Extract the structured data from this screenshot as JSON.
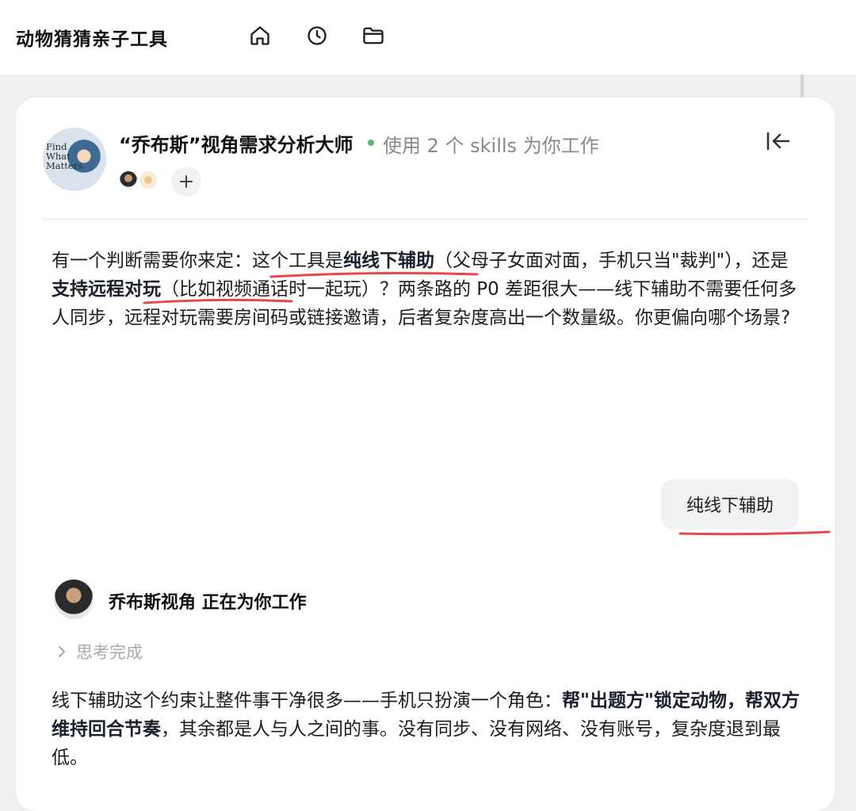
{
  "app": {
    "title": "动物猜猜亲子工具",
    "nav_icons": [
      "home-icon",
      "history-icon",
      "folder-icon"
    ]
  },
  "agent": {
    "logo_text": "Find\nWhat\nMatters.",
    "name": "“乔布斯”视角需求分析大师",
    "status": "使用 2 个 skills 为你工作",
    "status_color": "#5db56d"
  },
  "messages": {
    "assistant_question": {
      "p1": "有一个判断需要你来定：",
      "p2": "这个工具是",
      "p3": "纯线下辅助",
      "p4": "（父母子女面对面，手机只当\"裁判\"），还是",
      "p5": "支持远程对玩",
      "p6": "（比如视频通话时一起玩）？两条路的 P0 差距很大——线下辅助不需要任何多人同步，远程对玩需要房间码或链接邀请，后者复杂度高出一个数量级。你更偏向哪个场景?"
    },
    "user_reply": "纯线下辅助",
    "worker": {
      "status": "乔布斯视角 正在为你工作",
      "thinking": "思考完成"
    },
    "assistant_answer": {
      "p1": "线下辅助这个约束让整件事干净很多——手机只扮演一个角色：",
      "p2": "帮\"出题方\"锁定动物，帮双方维持回合节奏",
      "p3": "，其余都是人与人之间的事。没有同步、没有网络、没有账号，复杂度退到最低。"
    }
  },
  "colors": {
    "accent_underline": "#e5484d",
    "highlight_text": "#1b1f2c"
  }
}
